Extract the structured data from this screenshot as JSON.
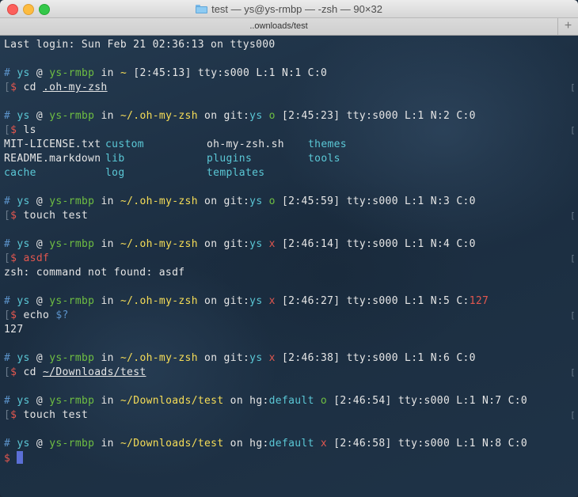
{
  "window": {
    "title": "test — ys@ys-rmbp — -zsh — 90×32",
    "tab_title": "..ownloads/test",
    "tab_add_label": "+"
  },
  "colors": {
    "green": "#6fbf42",
    "blue": "#5b92c9",
    "yellow": "#f6dd57",
    "cyan": "#5bc8d6",
    "red": "#e2574f",
    "cursor": "#5b6fd6"
  },
  "terminal": {
    "last_login": "Last login: Sun Feb 21 02:36:13 on ttys000",
    "prompts": [
      {
        "hash": "#",
        "user": "ys",
        "at": "@",
        "host": "ys-rmbp",
        "in": "in",
        "path": "~",
        "vcs_on": "",
        "vcs": "",
        "vcs_branch": "",
        "vcs_status": "",
        "time": "[2:45:13]",
        "tty": "tty:s000",
        "line": "L:1",
        "n": "N:1",
        "code": "C:0",
        "cmd_prefix": "$",
        "cmd": "cd",
        "arg": ".oh-my-zsh"
      },
      {
        "hash": "#",
        "user": "ys",
        "at": "@",
        "host": "ys-rmbp",
        "in": "in",
        "path": "~/.oh-my-zsh",
        "vcs_on": "on",
        "vcs": "git:",
        "vcs_branch": "ys",
        "vcs_status": "o",
        "time": "[2:45:23]",
        "tty": "tty:s000",
        "line": "L:1",
        "n": "N:2",
        "code": "C:0",
        "cmd_prefix": "$",
        "cmd": "ls",
        "arg": ""
      },
      {
        "hash": "#",
        "user": "ys",
        "at": "@",
        "host": "ys-rmbp",
        "in": "in",
        "path": "~/.oh-my-zsh",
        "vcs_on": "on",
        "vcs": "git:",
        "vcs_branch": "ys",
        "vcs_status": "o",
        "time": "[2:45:59]",
        "tty": "tty:s000",
        "line": "L:1",
        "n": "N:3",
        "code": "C:0",
        "cmd_prefix": "$",
        "cmd": "touch",
        "arg": "test"
      },
      {
        "hash": "#",
        "user": "ys",
        "at": "@",
        "host": "ys-rmbp",
        "in": "in",
        "path": "~/.oh-my-zsh",
        "vcs_on": "on",
        "vcs": "git:",
        "vcs_branch": "ys",
        "vcs_status": "x",
        "time": "[2:46:14]",
        "tty": "tty:s000",
        "line": "L:1",
        "n": "N:4",
        "code": "C:0",
        "cmd_prefix": "$",
        "cmd": "asdf",
        "arg": ""
      },
      {
        "hash": "#",
        "user": "ys",
        "at": "@",
        "host": "ys-rmbp",
        "in": "in",
        "path": "~/.oh-my-zsh",
        "vcs_on": "on",
        "vcs": "git:",
        "vcs_branch": "ys",
        "vcs_status": "x",
        "time": "[2:46:27]",
        "tty": "tty:s000",
        "line": "L:1",
        "n": "N:5",
        "code": "C:",
        "code_value": "127",
        "cmd_prefix": "$",
        "cmd": "echo",
        "arg": "$?"
      },
      {
        "hash": "#",
        "user": "ys",
        "at": "@",
        "host": "ys-rmbp",
        "in": "in",
        "path": "~/.oh-my-zsh",
        "vcs_on": "on",
        "vcs": "git:",
        "vcs_branch": "ys",
        "vcs_status": "x",
        "time": "[2:46:38]",
        "tty": "tty:s000",
        "line": "L:1",
        "n": "N:6",
        "code": "C:0",
        "cmd_prefix": "$",
        "cmd": "cd",
        "arg": "~/Downloads/test"
      },
      {
        "hash": "#",
        "user": "ys",
        "at": "@",
        "host": "ys-rmbp",
        "in": "in",
        "path": "~/Downloads/test",
        "vcs_on": "on",
        "vcs": "hg:",
        "vcs_branch": "default",
        "vcs_status": "o",
        "time": "[2:46:54]",
        "tty": "tty:s000",
        "line": "L:1",
        "n": "N:7",
        "code": "C:0",
        "cmd_prefix": "$",
        "cmd": "touch",
        "arg": "test"
      },
      {
        "hash": "#",
        "user": "ys",
        "at": "@",
        "host": "ys-rmbp",
        "in": "in",
        "path": "~/Downloads/test",
        "vcs_on": "on",
        "vcs": "hg:",
        "vcs_branch": "default",
        "vcs_status": "x",
        "time": "[2:46:58]",
        "tty": "tty:s000",
        "line": "L:1",
        "n": "N:8",
        "code": "C:0",
        "cmd_prefix": "$",
        "cmd": "",
        "arg": ""
      }
    ],
    "ls_output": [
      [
        "MIT-LICENSE.txt",
        "custom",
        "oh-my-zsh.sh",
        "themes"
      ],
      [
        "README.markdown",
        "lib",
        "plugins",
        "tools"
      ],
      [
        "cache",
        "log",
        "templates",
        ""
      ]
    ],
    "outputs": {
      "asdf_error": "zsh: command not found: asdf",
      "echo_result": "127"
    }
  }
}
